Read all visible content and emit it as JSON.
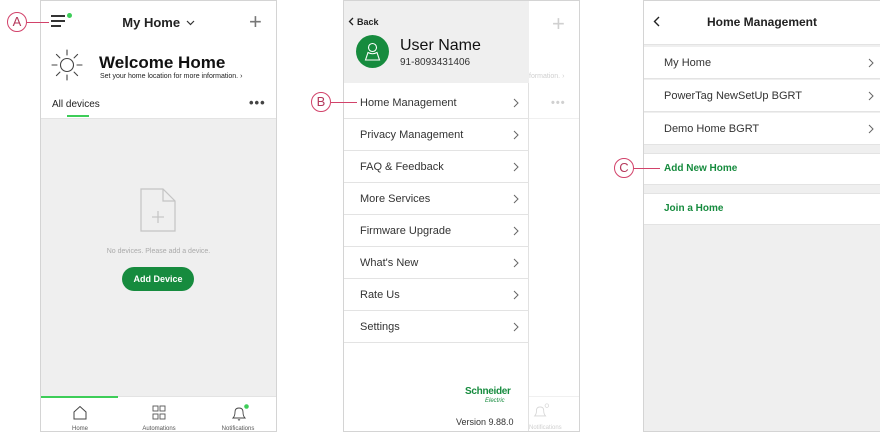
{
  "colors": {
    "accent": "#168b3e",
    "accent_light": "#3dcd58",
    "callout": "#d2426a"
  },
  "screen1": {
    "title": "My Home",
    "welcome_title": "Welcome Home",
    "welcome_subtitle": "Set your home location for more information. ›",
    "tab_label": "All devices",
    "more_label": "•••",
    "empty_text": "No devices. Please add a device.",
    "add_device_label": "Add Device",
    "nav": [
      {
        "label": "Home",
        "icon": "home-icon",
        "active": true
      },
      {
        "label": "Automations",
        "icon": "automations-grid-icon",
        "active": false
      },
      {
        "label": "Notifications",
        "icon": "bell-icon",
        "active": false
      }
    ]
  },
  "screen2": {
    "back_label": "Back",
    "user_name": "User Name",
    "user_phone": "91-8093431406",
    "menu": [
      "Home Management",
      "Privacy Management",
      "FAQ & Feedback",
      "More Services",
      "Firmware Upgrade",
      "What's New",
      "Rate Us",
      "Settings"
    ],
    "ghost_subtitle": "formation. ›",
    "ghost_nav_label": "Notifications",
    "logo_text": "Schneider",
    "logo_sub": "Electric",
    "version": "Version 9.88.0"
  },
  "screen3": {
    "title": "Home Management",
    "homes": [
      "My Home",
      "PowerTag NewSetUp BGRT",
      "Demo Home BGRT"
    ],
    "add_new_home": "Add New Home",
    "join_home": "Join a Home"
  },
  "callouts": {
    "a": "A",
    "b": "B",
    "c": "C"
  }
}
